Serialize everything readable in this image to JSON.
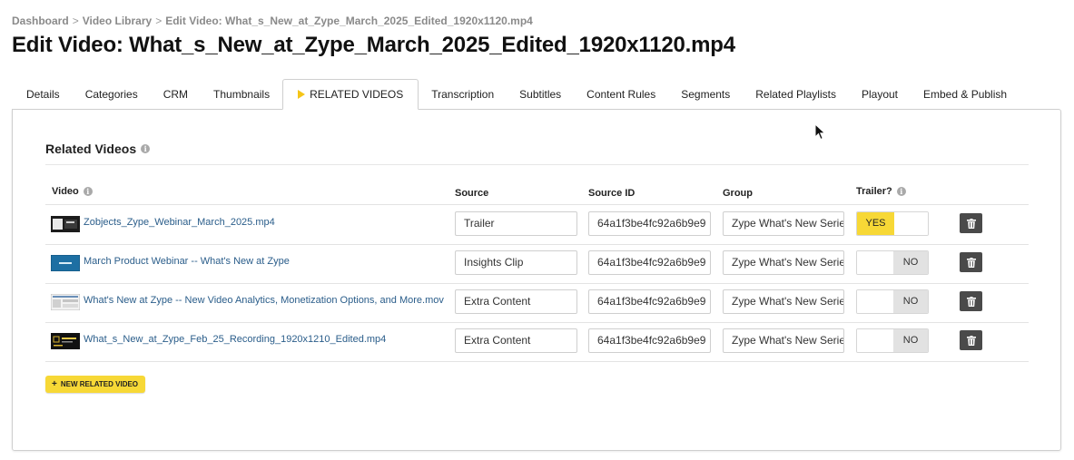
{
  "breadcrumb": [
    "Dashboard",
    "Video Library",
    "Edit Video: What_s_New_at_Zype_March_2025_Edited_1920x1120.mp4"
  ],
  "page_title": "Edit Video: What_s_New_at_Zype_March_2025_Edited_1920x1120.mp4",
  "tabs": [
    "Details",
    "Categories",
    "CRM",
    "Thumbnails",
    "RELATED VIDEOS",
    "Transcription",
    "Subtitles",
    "Content Rules",
    "Segments",
    "Related Playlists",
    "Playout",
    "Embed & Publish"
  ],
  "active_tab": "RELATED VIDEOS",
  "section_title": "Related Videos",
  "columns": {
    "video": "Video",
    "source": "Source",
    "source_id": "Source ID",
    "group": "Group",
    "trailer": "Trailer?"
  },
  "rows": [
    {
      "video": "Zobjects_Zype_Webinar_March_2025.mp4",
      "source": "Trailer",
      "source_id": "64a1f3be4fc92a6b9e9",
      "group": "Zype What's New Series",
      "trailer_label": "YES",
      "trailer": true
    },
    {
      "video": "March Product Webinar -- What's New at Zype",
      "source": "Insights Clip",
      "source_id": "64a1f3be4fc92a6b9e9",
      "group": "Zype What's New Series",
      "trailer_label": "NO",
      "trailer": false
    },
    {
      "video": "What's New at Zype -- New Video Analytics, Monetization Options, and More.mov",
      "source": "Extra Content",
      "source_id": "64a1f3be4fc92a6b9e9",
      "group": "Zype What's New Series",
      "trailer_label": "NO",
      "trailer": false
    },
    {
      "video": "What_s_New_at_Zype_Feb_25_Recording_1920x1210_Edited.mp4",
      "source": "Extra Content",
      "source_id": "64a1f3be4fc92a6b9e9",
      "group": "Zype What's New Series",
      "trailer_label": "NO",
      "trailer": false
    }
  ],
  "new_button_label": "NEW RELATED VIDEO",
  "colors": {
    "accent_yellow": "#f7d836",
    "link_blue": "#2a5d8a",
    "trash_button": "#4a4a4a"
  }
}
